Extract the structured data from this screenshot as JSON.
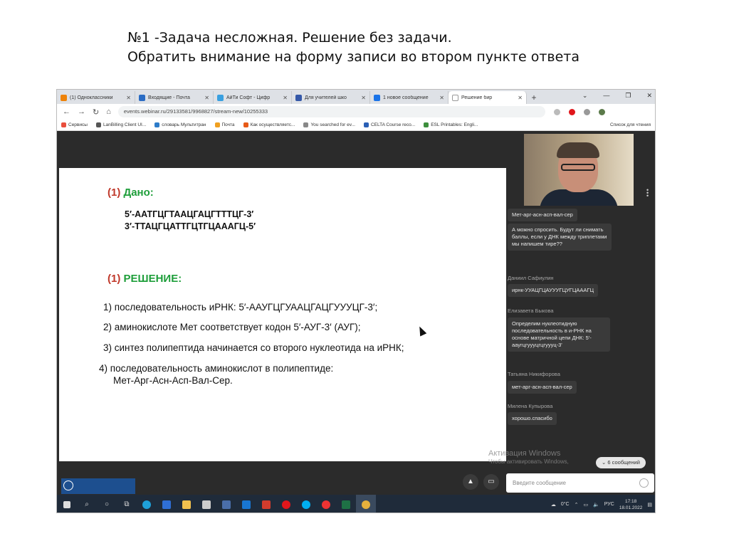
{
  "slide_heading": {
    "line1": "№1 -Задача несложная. Решение без задачи.",
    "line2": "Обратить внимание на форму записи во втором пункте ответа"
  },
  "browser": {
    "tabs": [
      {
        "label": "(1) Одноклассники",
        "color": "#ee8208"
      },
      {
        "label": "Входящие - Почта",
        "color": "#2b6cc4"
      },
      {
        "label": "АйТи Софт - Цифр",
        "color": "#3aa0e0"
      },
      {
        "label": "Для учителей шко",
        "color": "#3558a8"
      },
      {
        "label": "1 новое сообщение",
        "color": "#1a73e8"
      },
      {
        "label": "Решение бир",
        "color": "#ffffff"
      }
    ],
    "new_tab": "+",
    "url": "events.webinar.ru/29133581/9968827/stream-new/10255333",
    "bookmarks": [
      "Сервисы",
      "LanBilling Client UI...",
      "словарь Мультитран",
      "Почта",
      "Как осуществляетс...",
      "You searched for ev...",
      "CELTA Course reco...",
      "ESL Printables: Engli..."
    ],
    "reading_list": "Список для чтения"
  },
  "slide": {
    "given_num": "(1)",
    "given_label": "Дано:",
    "dna1": "5′-ААТГЦГТААЦГАЦГТТТЦГ-3′",
    "dna2": "3′-ТТАЦГЦАТТГЦТГЦАААГЦ-5′",
    "solution_num": "(1)",
    "solution_label": "РЕШЕНИЕ:",
    "steps": [
      "1) последовательность иРНК: 5′-ААУГЦГУААЦГАЦГУУУЦГ-3′;",
      "2) аминокислоте Мет соответствует кодон 5′-АУГ-3′ (АУГ);",
      "3) синтез полипептида начинается со второго нуклеотида на иРНК;",
      "4) последовательность аминокислот в полипептиде:",
      "Мет-Арг-Асн-Асп-Вал-Сер."
    ]
  },
  "chat": {
    "msg0": "Мет-арг-асн-асп-вал-сер",
    "msg1": "А можно спросить. Будут ли снимать баллы, если у ДНК между триплетами мы напишем тире??",
    "name2": "Даниил Сафиулин",
    "msg2": "ирнк-УУАЦГЦАУУУГЦУГЦАААГЦ",
    "name3": "Елизавета Быкова",
    "msg3": "Определим нуклеотидную последовательность в и-РНК на основе матричной цепи ДНК: 5'-ааугцгуууцгцгуууц-3'",
    "name4": "Татьяна Никифорова",
    "msg4": "мет-арг-асн-асп-вал-сер",
    "name5": "Милена Купырова",
    "msg5": "хорошо.спасибо",
    "new_messages": "6 сообщений",
    "input_placeholder": "Введите сообщение"
  },
  "watermark": {
    "line1": "Активация Windows",
    "line2": "Чтобы активировать Windows,"
  },
  "taskbar": {
    "weather": "0°C",
    "lang": "РУС",
    "time": "17:18",
    "date": "18.01.2022"
  },
  "colors": {
    "section_red": "#c0392b",
    "section_green": "#1e9e3a",
    "panel_dark": "#2b2b2b",
    "taskbar": "#1f2b3a"
  }
}
